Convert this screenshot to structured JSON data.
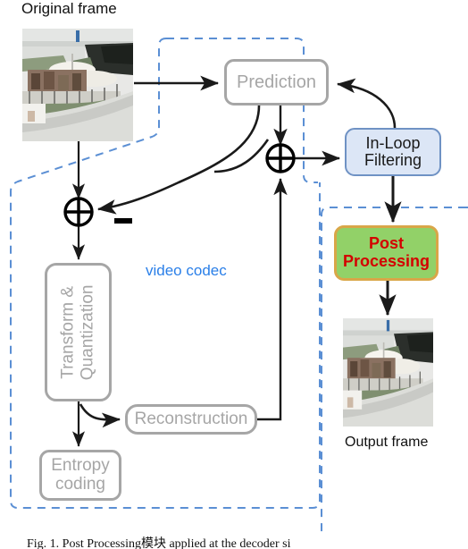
{
  "figure": {
    "labels": {
      "original_frame": "Original frame",
      "output_frame": "Output frame",
      "video_codec": "video codec"
    },
    "boxes": {
      "prediction": "Prediction",
      "in_loop_filtering": "In-Loop\nFiltering",
      "in_loop_filtering_line1": "In-Loop",
      "in_loop_filtering_line2": "Filtering",
      "post_processing_line1": "Post",
      "post_processing_line2": "Processing",
      "transform_line1": "Transform &",
      "transform_line2": "Quantization",
      "reconstruction": "Reconstruction",
      "entropy_line1": "Entropy",
      "entropy_line2": "coding"
    },
    "operators": {
      "subtractor_sign": "−",
      "adder_glyph": "⊕"
    },
    "caption": "Fig. 1. Post Processing模块 applied at the decoder si",
    "colors": {
      "codec_boundary": "#5b8fd4",
      "video_codec_text": "#2a7fe8",
      "gray_box_border": "#a6a6a6",
      "gray_box_text": "#a6a6a6",
      "inloop_fill": "#dce6f6",
      "inloop_border": "#6f92c4",
      "postproc_fill": "#92d168",
      "postproc_border": "#d9a648",
      "postproc_text": "#d40000",
      "arrow": "#1a1a1a"
    }
  }
}
